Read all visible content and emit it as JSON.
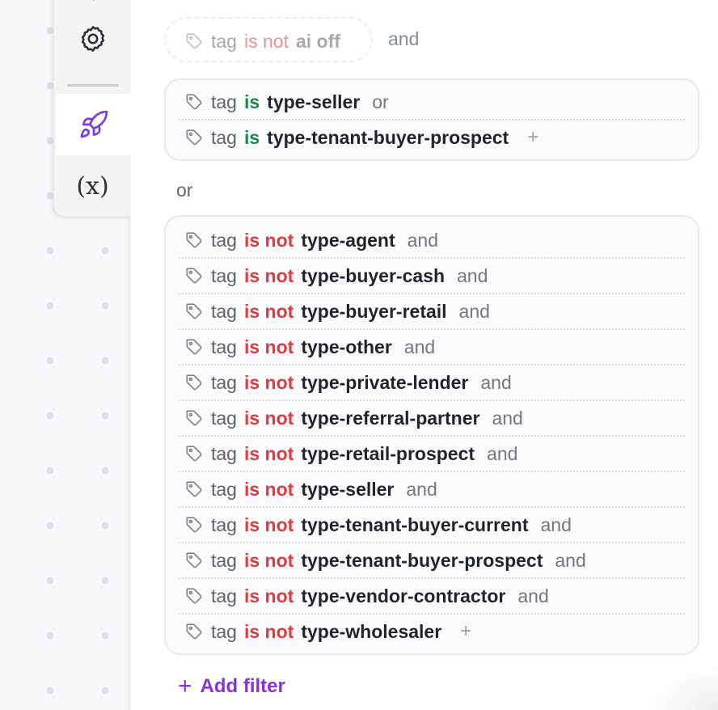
{
  "toolbar": {
    "items": [
      {
        "name": "settings",
        "icon": "gear-icon"
      },
      {
        "name": "rocket",
        "icon": "rocket-icon",
        "active": true
      },
      {
        "name": "variables",
        "icon": "variable-icon",
        "label": "(x)"
      }
    ]
  },
  "ghost_filter": {
    "field": "tag",
    "operator": "is not",
    "value": "ai off",
    "conjunction": "and"
  },
  "group1": {
    "rows": [
      {
        "field": "tag",
        "operator": "is",
        "value": "type-seller",
        "conjunction": "or"
      },
      {
        "field": "tag",
        "operator": "is",
        "value": "type-tenant-buyer-prospect",
        "conjunction": "+"
      }
    ]
  },
  "between_groups": "or",
  "group2": {
    "rows": [
      {
        "field": "tag",
        "operator": "is not",
        "value": "type-agent",
        "conjunction": "and"
      },
      {
        "field": "tag",
        "operator": "is not",
        "value": "type-buyer-cash",
        "conjunction": "and"
      },
      {
        "field": "tag",
        "operator": "is not",
        "value": "type-buyer-retail",
        "conjunction": "and"
      },
      {
        "field": "tag",
        "operator": "is not",
        "value": "type-other",
        "conjunction": "and"
      },
      {
        "field": "tag",
        "operator": "is not",
        "value": "type-private-lender",
        "conjunction": "and"
      },
      {
        "field": "tag",
        "operator": "is not",
        "value": "type-referral-partner",
        "conjunction": "and"
      },
      {
        "field": "tag",
        "operator": "is not",
        "value": "type-retail-prospect",
        "conjunction": "and"
      },
      {
        "field": "tag",
        "operator": "is not",
        "value": "type-seller",
        "conjunction": "and"
      },
      {
        "field": "tag",
        "operator": "is not",
        "value": "type-tenant-buyer-current",
        "conjunction": "and"
      },
      {
        "field": "tag",
        "operator": "is not",
        "value": "type-tenant-buyer-prospect",
        "conjunction": "and"
      },
      {
        "field": "tag",
        "operator": "is not",
        "value": "type-vendor-contractor",
        "conjunction": "and"
      },
      {
        "field": "tag",
        "operator": "is not",
        "value": "type-wholesaler",
        "conjunction": "+"
      }
    ]
  },
  "add_filter": {
    "icon": "plus-icon",
    "plus": "+",
    "label": "Add filter"
  },
  "colors": {
    "operator_is": "#17894d",
    "operator_is_not": "#e0393e",
    "accent": "#8a2ee0",
    "rocket": "#7c3aed"
  }
}
